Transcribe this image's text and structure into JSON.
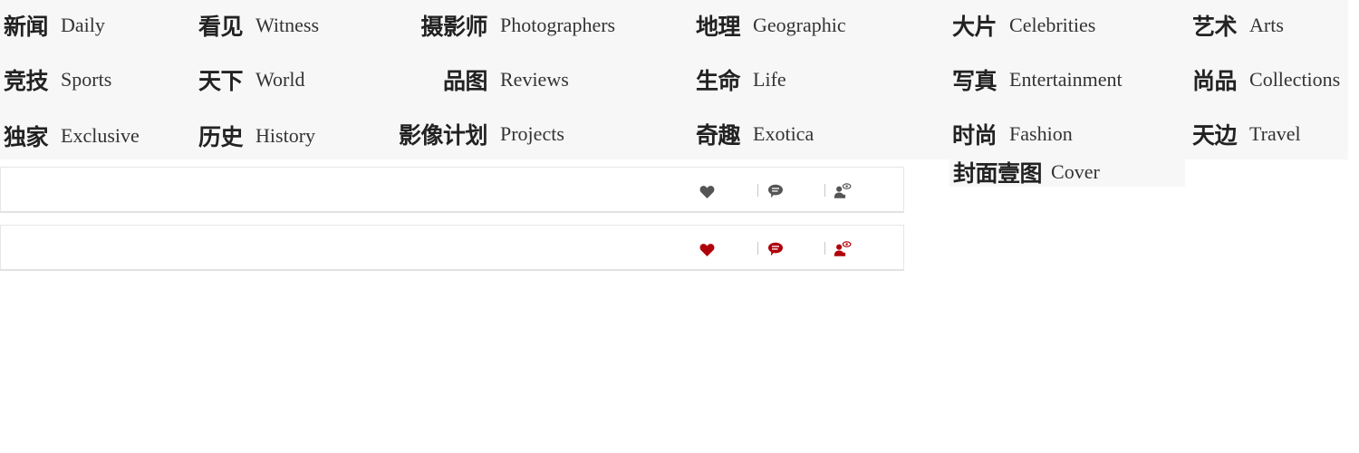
{
  "nav": {
    "columns": [
      {
        "items": [
          {
            "zh": "新闻",
            "en": "Daily"
          },
          {
            "zh": "竞技",
            "en": "Sports"
          },
          {
            "zh": "独家",
            "en": "Exclusive"
          }
        ]
      },
      {
        "items": [
          {
            "zh": "看见",
            "en": "Witness"
          },
          {
            "zh": "天下",
            "en": "World"
          },
          {
            "zh": "历史",
            "en": "History"
          }
        ]
      },
      {
        "items": [
          {
            "zh": "摄影师",
            "en": "Photographers"
          },
          {
            "zh": "品图",
            "en": "Reviews"
          },
          {
            "zh": "影像计划",
            "en": "Projects"
          }
        ]
      },
      {
        "items": [
          {
            "zh": "地理",
            "en": "Geographic"
          },
          {
            "zh": "生命",
            "en": "Life"
          },
          {
            "zh": "奇趣",
            "en": "Exotica"
          }
        ]
      },
      {
        "items": [
          {
            "zh": "大片",
            "en": "Celebrities"
          },
          {
            "zh": "写真",
            "en": "Entertainment"
          },
          {
            "zh": "时尚",
            "en": "Fashion"
          }
        ]
      },
      {
        "items": [
          {
            "zh": "艺术",
            "en": "Arts"
          },
          {
            "zh": "尚品",
            "en": "Collections"
          },
          {
            "zh": "天边",
            "en": "Travel"
          }
        ]
      }
    ],
    "cover": {
      "zh": "封面壹图",
      "en": "Cover"
    }
  },
  "action_bars": [
    {
      "state": "default",
      "color": "#555555",
      "icons": [
        "heart-icon",
        "comment-icon",
        "viewer-icon"
      ]
    },
    {
      "state": "active",
      "color": "#b0000a",
      "icons": [
        "heart-icon",
        "comment-icon",
        "viewer-icon"
      ]
    }
  ],
  "colors": {
    "menu_background": "#f7f7f7",
    "text": "#222222",
    "icon_default": "#555555",
    "icon_active": "#b0000a"
  }
}
